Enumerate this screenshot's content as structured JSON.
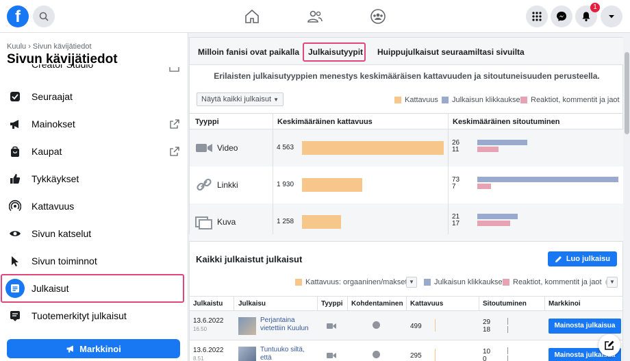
{
  "topbar": {
    "logo_letter": "f",
    "notifications_count": "1",
    "icons": [
      "search-icon",
      "home-icon",
      "friends-icon",
      "groups-icon",
      "menu-grid-icon",
      "messenger-icon",
      "bell-icon",
      "caret-down-icon"
    ]
  },
  "sidebar": {
    "breadcrumb": "Kuulu › Sivun kävijätiedot",
    "title": "Sivun kävijätiedot",
    "cut_item": "Creator Studio",
    "items": [
      {
        "label": "Seuraajat",
        "icon": "check-box-icon",
        "external": false
      },
      {
        "label": "Mainokset",
        "icon": "megaphone-icon",
        "external": true
      },
      {
        "label": "Kaupat",
        "icon": "shop-bag-icon",
        "external": true
      },
      {
        "label": "Tykkäykset",
        "icon": "thumbs-up-icon",
        "external": false
      },
      {
        "label": "Kattavuus",
        "icon": "broadcast-icon",
        "external": false
      },
      {
        "label": "Sivun katselut",
        "icon": "eye-icon",
        "external": false
      },
      {
        "label": "Sivun toiminnot",
        "icon": "cursor-icon",
        "external": false
      },
      {
        "label": "Julkaisut",
        "icon": "posts-icon",
        "external": false,
        "active": true
      },
      {
        "label": "Tuotemerkityt julkaisut",
        "icon": "tagged-posts-icon",
        "external": false
      }
    ],
    "promote_label": "Markkinoi"
  },
  "insights": {
    "tabs": [
      "Milloin fanisi ovat paikalla",
      "Julkaisutyypit",
      "Huippujulkaisut seuraamiltasi sivuilta"
    ],
    "active_tab": "Julkaisutyypit",
    "subtitle": "Erilaisten julkaisutyyppien menestys keskimääräisen kattavuuden ja sitoutuneisuuden perusteella.",
    "filter_label": "Näytä kaikki julkaisut",
    "legend": [
      {
        "label": "Kattavuus",
        "color": "#f7c68a"
      },
      {
        "label": "Julkaisun klikkaukset",
        "color": "#9aaacf"
      },
      {
        "label": "Reaktiot, kommentit ja jaot",
        "color": "#e5a3b3"
      }
    ],
    "headers": {
      "type": "Tyyppi",
      "avg_reach": "Keskimääräinen kattavuus",
      "avg_engagement": "Keskimääräinen sitoutuminen"
    },
    "rows": [
      {
        "type": "Video",
        "reach_label": "4 563",
        "reach": 4563,
        "clicks": 26,
        "reactions": 11,
        "icon": "video-icon"
      },
      {
        "type": "Linkki",
        "reach_label": "1 930",
        "reach": 1930,
        "clicks": 73,
        "reactions": 7,
        "icon": "link-icon"
      },
      {
        "type": "Kuva",
        "reach_label": "1 258",
        "reach": 1258,
        "clicks": 21,
        "reactions": 17,
        "icon": "photo-icon"
      }
    ]
  },
  "posts": {
    "title": "Kaikki julkaistut julkaisut",
    "create_label": "Luo julkaisu",
    "legend": [
      {
        "label": "Kattavuus: orgaaninen/maksettu",
        "color": "#f7c68a"
      },
      {
        "label": "Julkaisun klikkaukset",
        "color": "#9aaacf"
      },
      {
        "label": "Reaktiot, kommentit ja jaot",
        "color": "#e5a3b3"
      }
    ],
    "headers": [
      "Julkaistu",
      "Julkaisu",
      "Tyyppi",
      "Kohdentaminen",
      "Kattavuus",
      "Sitoutuminen",
      "Markkinoi"
    ],
    "rows": [
      {
        "date": "13.6.2022",
        "time": "16.50",
        "title": "Perjantaina vietettiin Kuulun",
        "reach": "499",
        "clicks": "29",
        "reactions": "18",
        "boost": "Mainosta julkaisua"
      },
      {
        "date": "13.6.2022",
        "time": "8.51",
        "title": "Tuntuuko siltä, että",
        "reach": "295",
        "clicks": "10",
        "reactions": "0",
        "boost": "Mainosta julkaisua"
      }
    ]
  }
}
